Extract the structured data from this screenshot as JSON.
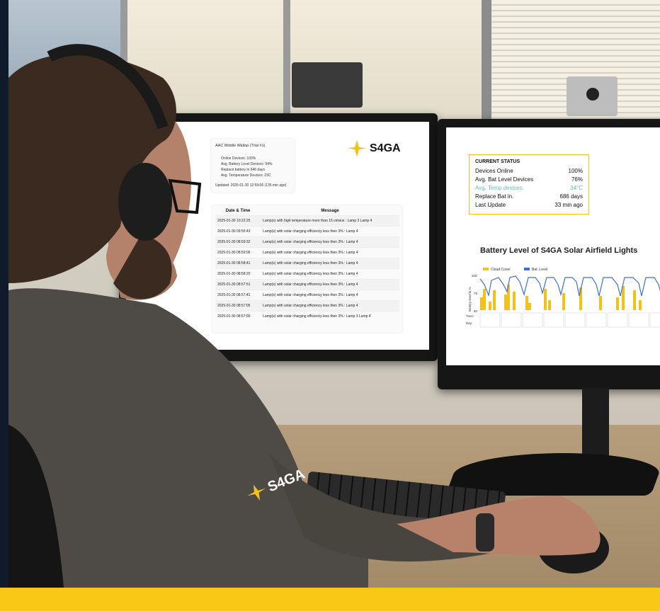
{
  "left_screen": {
    "site_card": {
      "title": "AAC Middle Wallop (Trial #1)",
      "lines": [
        "Online Devices: 100%",
        "Avg. Battery Level Devices: 94%",
        "Replace battery in 646 days",
        "Avg. Temperature Devices: 23C"
      ],
      "updated": "Updated: 2025-01-30 12:59:06 (135 min ago)"
    },
    "logo_text": "S4GA",
    "log_table": {
      "headers": [
        "Date & Time",
        "Message"
      ],
      "rows": [
        [
          "2025-01-30 10:22:25",
          "Lamp(s) with high temperature more than 15 celsius : Lamp 3 Lamp 4"
        ],
        [
          "2025-01-30 09:55:43",
          "Lamp(s) with solar charging efficiency less then 3% : Lamp 4"
        ],
        [
          "2025-01-30 08:59:32",
          "Lamp(s) with solar charging efficiency less then 3% : Lamp 4"
        ],
        [
          "2025-01-30 08:59:06",
          "Lamp(s) with solar charging efficiency less then 3% : Lamp 4"
        ],
        [
          "2025-01-30 08:58:41",
          "Lamp(s) with solar charging efficiency less then 3% : Lamp 4"
        ],
        [
          "2025-01-30 08:58:20",
          "Lamp(s) with solar charging efficiency less then 3% : Lamp 4"
        ],
        [
          "2025-01-30 08:57:51",
          "Lamp(s) with solar charging efficiency less then 3% : Lamp 4"
        ],
        [
          "2025-01-30 08:57:41",
          "Lamp(s) with solar charging efficiency less then 3% : Lamp 4"
        ],
        [
          "2025-01-30 08:57:05",
          "Lamp(s) with solar charging efficiency less then 3% : Lamp 4"
        ],
        [
          "2025-01-30 08:57:00",
          "Lamp(s) with solar charging efficiency less then 3% : Lamp 3 Lamp 4"
        ]
      ]
    }
  },
  "right_screen": {
    "current_status": {
      "title": "CURRENT STATUS",
      "rows": [
        {
          "label": "Devices Online",
          "value": "100%",
          "highlight": false
        },
        {
          "label": "Avg. Bat Level Devices",
          "value": "76%",
          "highlight": false
        },
        {
          "label": "Avg. Temp devices.",
          "value": "34°C",
          "highlight": true
        },
        {
          "label": "Replace Bat in.",
          "value": "686 days",
          "highlight": false
        },
        {
          "label": "Last Update",
          "value": "33 min ago",
          "highlight": false
        }
      ]
    },
    "chart_title": "Battery Level of S4GA Solar Airfield Lights",
    "legend": [
      "Cloud Cover",
      "Bat. Level"
    ],
    "ylabel": "Battery level in %",
    "y_ticks": [
      "100",
      "75",
      "50"
    ],
    "row_labels": [
      "Time:",
      "Day:"
    ]
  },
  "shirt_logo": "S4GA",
  "colors": {
    "brand_yellow": "#f9c816",
    "chart_yellow": "#f2c21b",
    "line_blue": "#3c6fd8",
    "temp_teal": "#5ec6b8"
  }
}
